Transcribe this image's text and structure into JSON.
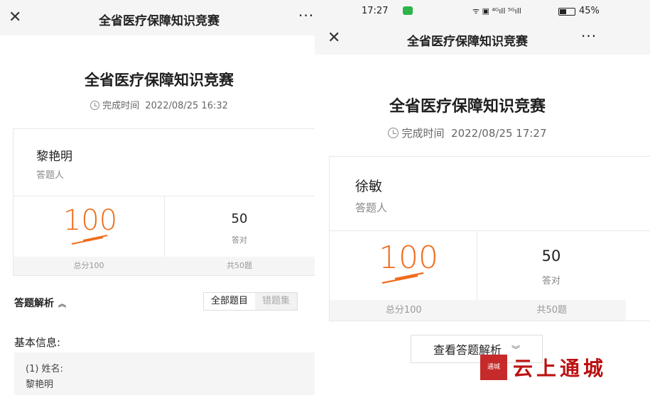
{
  "left": {
    "header": {
      "title": "全省医疗保障知识竞赛",
      "close_icon": "close-icon",
      "more_icon": "more-icon"
    },
    "quiz_title": "全省医疗保障知识竞赛",
    "completion": {
      "label": "完成时间",
      "value": "2022/08/25 16:32"
    },
    "respondent": {
      "name": "黎艳明",
      "role": "答题人"
    },
    "stats": {
      "score": "100",
      "correct": "50",
      "correct_label": "答对",
      "total_score_label": "总分100",
      "total_questions_label": "共50题"
    },
    "analysis": {
      "title": "答题解析",
      "tab_all": "全部题目",
      "tab_wrong": "错题集"
    },
    "basic_info": {
      "title": "基本信息:",
      "q1_label": "(1) 姓名:",
      "q1_value": "黎艳明"
    }
  },
  "right": {
    "status_bar": {
      "time": "17:27",
      "battery": "45%",
      "signal": "ᯤ ▣ ⁴ᴳıll ⁵ᴳıll"
    },
    "header": {
      "title": "全省医疗保障知识竞赛"
    },
    "quiz_title": "全省医疗保障知识竞赛",
    "completion": {
      "label": "完成时间",
      "value": "2022/08/25 17:27"
    },
    "respondent": {
      "name": "徐敏",
      "role": "答题人"
    },
    "stats": {
      "score": "100",
      "correct": "50",
      "correct_label": "答对",
      "total_score_label": "总分100",
      "total_questions_label": "共50题"
    },
    "view_analysis_button": "查看答题解析"
  },
  "watermark": {
    "text": "云上通城",
    "seal": "通城"
  },
  "colors": {
    "score_orange": "#ef6d1c",
    "background": "#f2f2f2"
  }
}
